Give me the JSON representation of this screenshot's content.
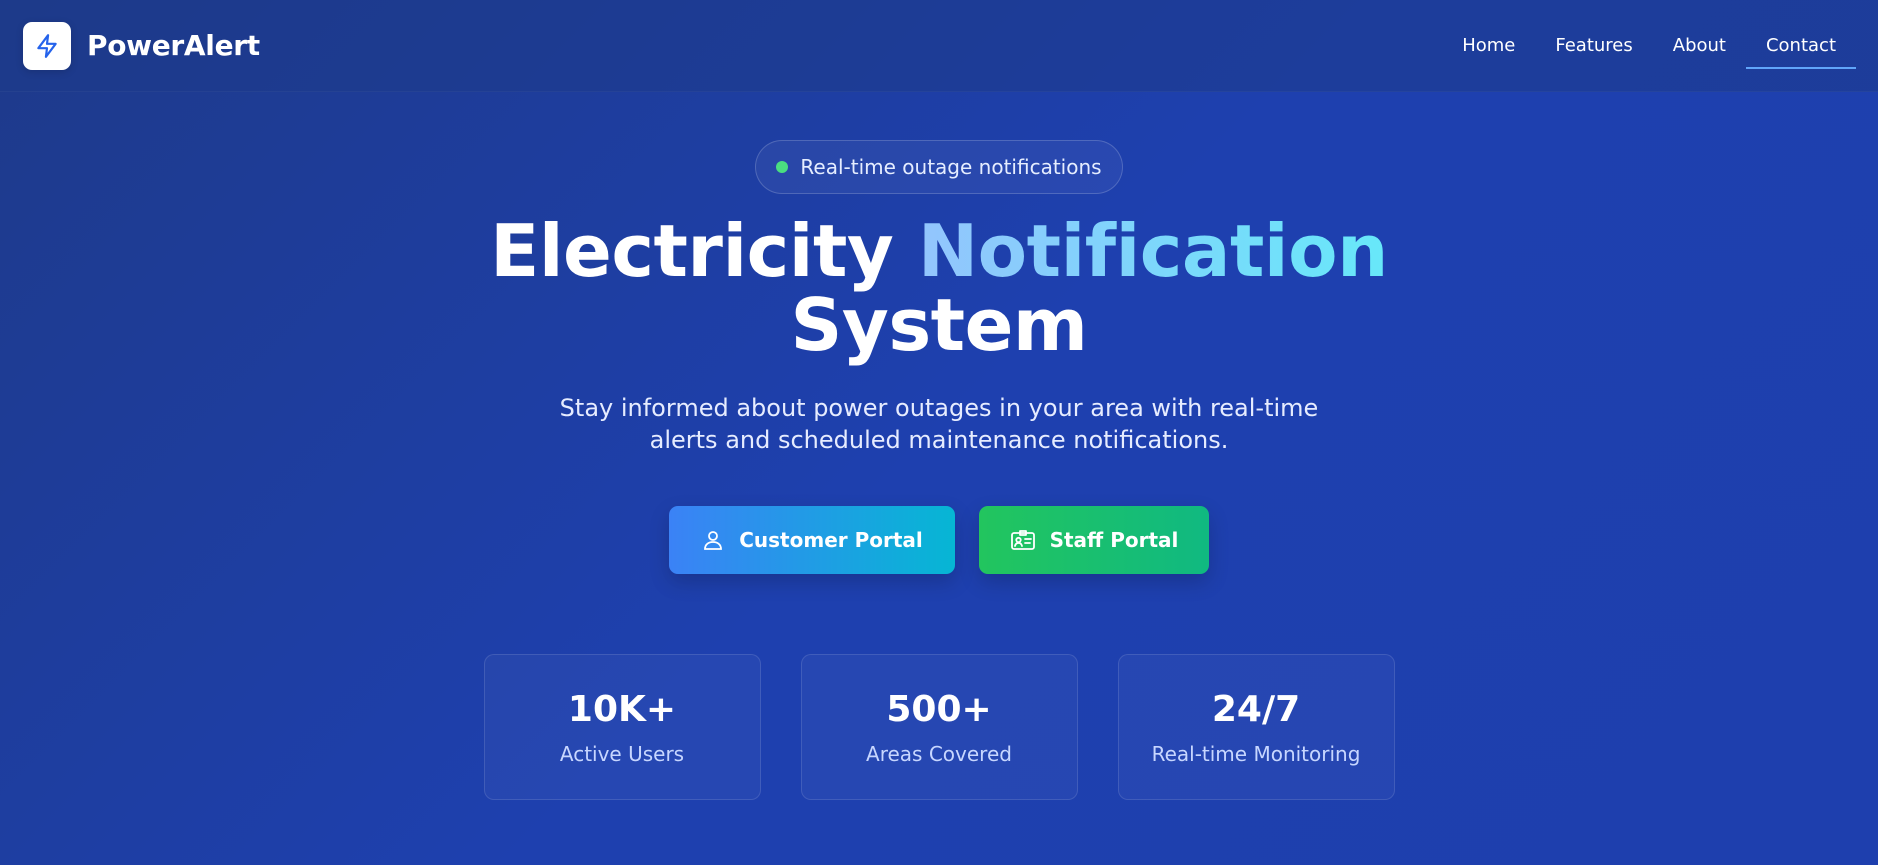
{
  "brand": {
    "name": "PowerAlert",
    "logo_icon": "lightning-bolt-icon"
  },
  "nav": {
    "items": [
      {
        "label": "Home"
      },
      {
        "label": "Features"
      },
      {
        "label": "About"
      },
      {
        "label": "Contact",
        "active": true
      }
    ]
  },
  "hero": {
    "badge": "Real-time outage notifications",
    "title_part1": "Electricity",
    "title_accent": "Notification",
    "title_part2": "System",
    "subtitle": "Stay informed about power outages in your area with real-time alerts and scheduled maintenance notifications."
  },
  "buttons": {
    "customer": {
      "label": "Customer Portal",
      "icon": "user-icon"
    },
    "staff": {
      "label": "Staff Portal",
      "icon": "id-badge-icon"
    }
  },
  "stats": [
    {
      "value": "10K+",
      "label": "Active Users"
    },
    {
      "value": "500+",
      "label": "Areas Covered"
    },
    {
      "value": "24/7",
      "label": "Real-time Monitoring"
    }
  ],
  "colors": {
    "background": "#1e40af",
    "accent_blue": "#3b82f6",
    "accent_cyan": "#06b6d4",
    "accent_green": "#22c55e",
    "status_dot": "#4ade80"
  }
}
